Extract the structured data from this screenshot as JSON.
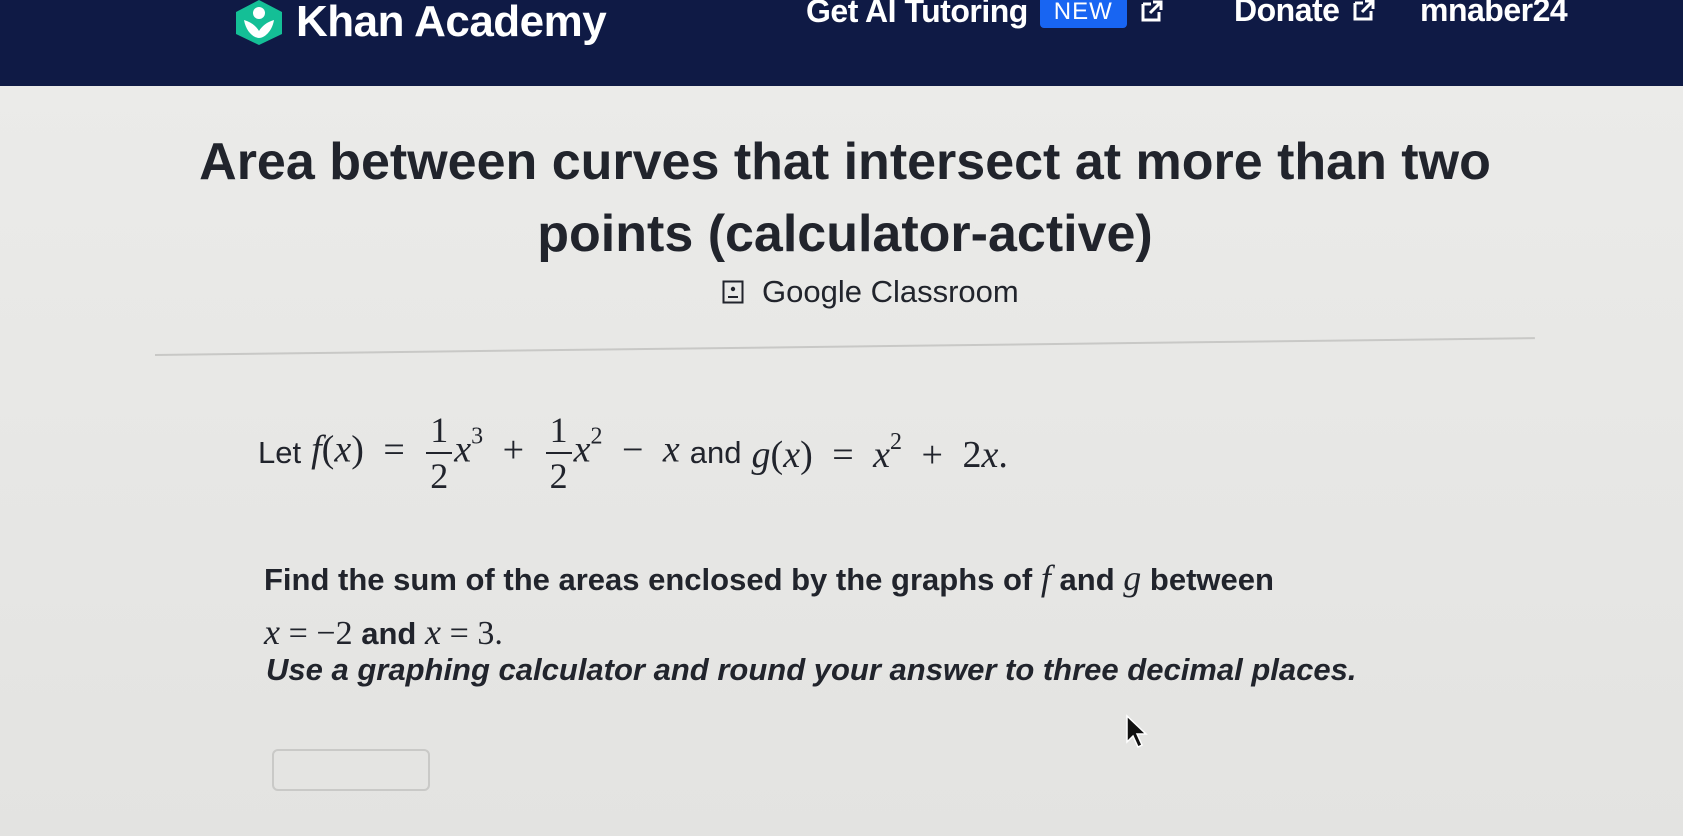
{
  "nav": {
    "brand": "Khan Academy",
    "tutoring": "Get AI Tutoring",
    "new_badge": "NEW",
    "donate": "Donate",
    "user": "mnaber24"
  },
  "page": {
    "title": "Area between curves that intersect at more than two points (calculator-active)",
    "classroom": "Google Classroom"
  },
  "problem": {
    "let": "Let",
    "f": "f",
    "x": "x",
    "one": "1",
    "two": "2",
    "exp3": "3",
    "exp2": "2",
    "and": "and",
    "g": "g",
    "two_x": "2",
    "find_text_1": "Find the sum of the areas enclosed by the graphs of",
    "find_and": "and",
    "find_between": "between",
    "lower_value": "−2",
    "upper_value": "3",
    "instructions": "Use a graphing calculator and round your answer to three decimal places."
  },
  "answer": {
    "value": ""
  },
  "colors": {
    "nav_bg": "#0f1a45",
    "badge": "#1865f2",
    "logo": "#14bf96"
  }
}
